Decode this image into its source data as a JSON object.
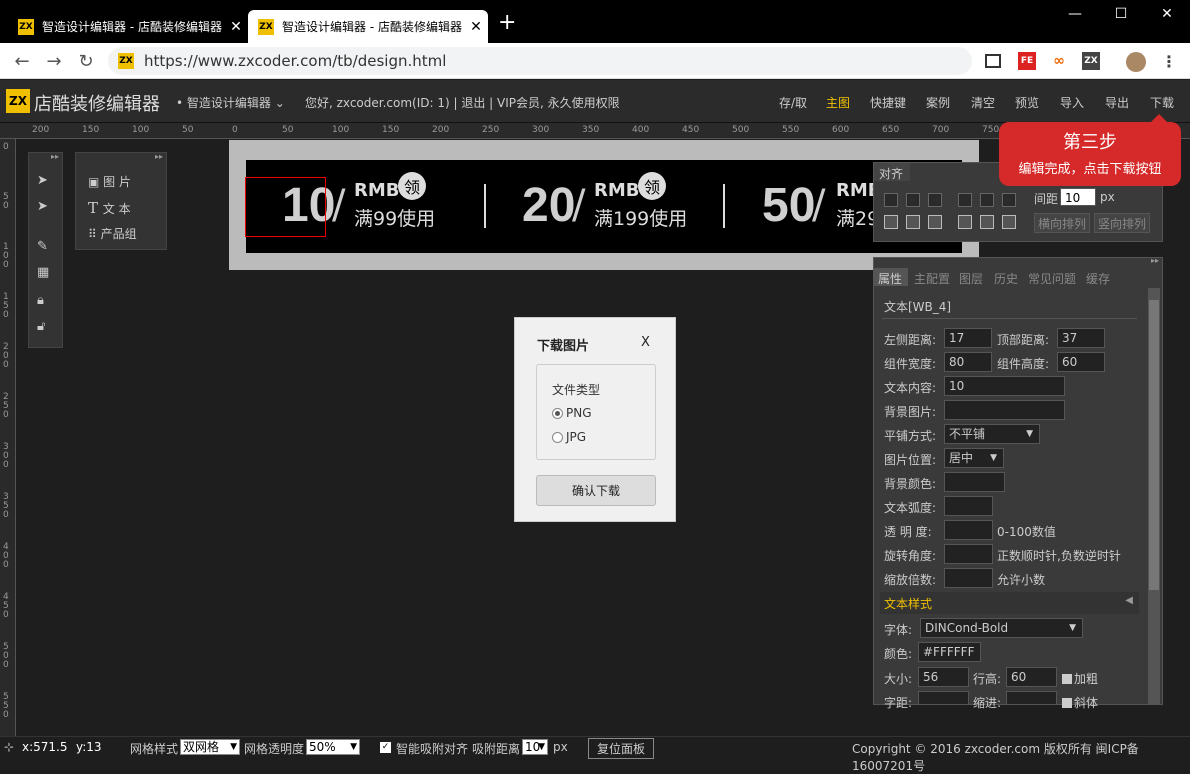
{
  "browser": {
    "tabs": [
      {
        "title": "智造设计编辑器 - 店酷装修编辑器",
        "favicon": "ZX"
      },
      {
        "title": "智造设计编辑器 - 店酷装修编辑器",
        "favicon": "ZX"
      }
    ],
    "new_tab": "+",
    "url": "https://www.zxcoder.com/tb/design.html",
    "extensions": [
      "FE",
      "∞",
      "ZX"
    ]
  },
  "app": {
    "logo": "ZX",
    "title": "店酷装修编辑器",
    "subtitle": "• 智造设计编辑器 ⌄",
    "user_info": "您好, zxcoder.com(ID: 1) | 退出 | VIP会员, 永久使用权限",
    "menu": [
      "存/取",
      "主图",
      "快捷键",
      "案例",
      "清空",
      "预览",
      "导入",
      "导出",
      "下载"
    ],
    "active_menu": "主图"
  },
  "ruler": {
    "top": [
      "200",
      "150",
      "100",
      "50",
      "0",
      "50",
      "100",
      "150",
      "200",
      "250",
      "300",
      "350",
      "400",
      "450",
      "500",
      "550",
      "600",
      "650",
      "700",
      "750"
    ],
    "left": [
      "0",
      "50",
      "100",
      "150",
      "200",
      "250",
      "300",
      "350",
      "400",
      "450",
      "500",
      "550"
    ]
  },
  "tools": {
    "components": [
      {
        "icon": "image-icon",
        "label": "图 片"
      },
      {
        "icon": "text-icon",
        "label": "文 本"
      },
      {
        "icon": "group-icon",
        "label": "产品组"
      }
    ]
  },
  "banner": {
    "coupons": [
      {
        "amount": "10",
        "currency": "RMB",
        "badge": "领",
        "condition": "满99使用"
      },
      {
        "amount": "20",
        "currency": "RMB",
        "badge": "领",
        "condition": "满199使用"
      },
      {
        "amount": "50",
        "currency": "RMB",
        "badge": "",
        "condition": "满29"
      }
    ]
  },
  "dialog": {
    "title": "下载图片",
    "close": "X",
    "group_label": "文件类型",
    "options": [
      "PNG",
      "JPG"
    ],
    "selected": "PNG",
    "confirm": "确认下载"
  },
  "align_panel": {
    "title": "对齐",
    "spacing_label": "间距",
    "spacing_value": "10",
    "unit": "px",
    "btn_horizontal": "横向排列",
    "btn_vertical": "竖向排列"
  },
  "callout": {
    "title": "第三步",
    "text": "编辑完成，点击下载按钮",
    "color": "#d62a2a"
  },
  "prop_panel": {
    "tabs": [
      "属性",
      "主配置",
      "图层",
      "历史",
      "常见问题",
      "缓存"
    ],
    "active_tab": "属性",
    "element_name": "文本[WB_4]",
    "left_label": "左侧距离:",
    "left_value": "17",
    "top_label": "顶部距离:",
    "top_value": "37",
    "width_label": "组件宽度:",
    "width_value": "80",
    "height_label": "组件高度:",
    "height_value": "60",
    "content_label": "文本内容:",
    "content_value": "10",
    "bgimg_label": "背景图片:",
    "tile_label": "平铺方式:",
    "tile_value": "不平铺",
    "imgpos_label": "图片位置:",
    "imgpos_value": "居中",
    "bgcolor_label": "背景颜色:",
    "arc_label": "文本弧度:",
    "opacity_label": "透  明  度:",
    "opacity_hint": "0-100数值",
    "rotate_label": "旋转角度:",
    "rotate_hint": "正数顺时针,负数逆时针",
    "scale_label": "缩放倍数:",
    "scale_hint": "允许小数",
    "section_style": "文本样式",
    "font_label": "字体:",
    "font_value": "DINCond-Bold",
    "color_label": "颜色:",
    "color_value": "#FFFFFF",
    "size_label": "大小:",
    "size_value": "56",
    "lineheight_label": "行高:",
    "lineheight_value": "60",
    "bold_label": "加粗",
    "spacing_label": "字距:",
    "indent_label": "缩进:",
    "italic_label": "斜体"
  },
  "status": {
    "x": "x:571.5",
    "y": "y:13",
    "grid_style_label": "网格样式",
    "grid_style_value": "双网格",
    "grid_opacity_label": "网格透明度",
    "grid_opacity_value": "50%",
    "snap_label": "智能吸附对齐",
    "snap_dist_label": "吸附距离",
    "snap_dist_value": "10",
    "snap_unit": "px",
    "reset_btn": "复位面板",
    "copyright": "Copyright © 2016 zxcoder.com 版权所有 闽ICP备16007201号"
  }
}
